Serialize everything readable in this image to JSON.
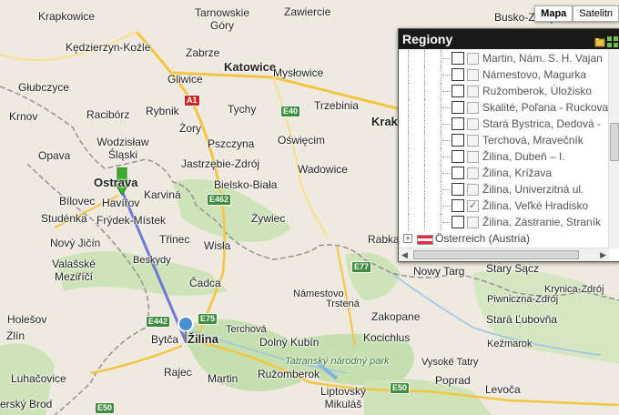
{
  "map_type": {
    "map_label": "Mapa",
    "satellite_label": "Satelitn"
  },
  "panel": {
    "title": "Regiony",
    "rows": [
      {
        "label": "Martin, Nám. S. H. Vajan",
        "checked": false
      },
      {
        "label": "Námestovo, Magurka",
        "checked": false
      },
      {
        "label": "Ružomberok, Úložisko",
        "checked": false
      },
      {
        "label": "Skalité, Poľana - Ruckova",
        "checked": false
      },
      {
        "label": "Stará Bystrica, Dedová -",
        "checked": false
      },
      {
        "label": "Terchová, Mravečník",
        "checked": false
      },
      {
        "label": "Žilina, Dubeň – I.",
        "checked": false
      },
      {
        "label": "Žilina, Krížava",
        "checked": false
      },
      {
        "label": "Žilina, Univerzitná ul.",
        "checked": false
      },
      {
        "label": "Žilina, Veľké Hradisko",
        "checked": true
      },
      {
        "label": "Žilina, Zástranie, Straník",
        "checked": false
      }
    ],
    "country": {
      "expander": "+",
      "label": "Österreich (Austria)"
    }
  },
  "map": {
    "places": {
      "krapkowice": "Krapkowice",
      "tarnowskie_gory": "Tarnowskie\nGóry",
      "zawiercie": "Zawiercie",
      "busko": "Busko-Zdrój",
      "kedzierzyn": "Kędzierzyn-Koźle",
      "zabrze": "Zabrze",
      "katowice": "Katowice",
      "gliwice": "Gliwice",
      "mieszowice": "Mysłowice",
      "glubczyce": "Głubczyce",
      "racibórz": "Racibórz",
      "rybnik": "Rybnik",
      "tychy": "Tychy",
      "trzebinia": "Trzebinia",
      "krnov": "Krnov",
      "zory": "Żory",
      "krak": "Krak",
      "wodzislaw": "Wodzisław\nŚląski",
      "pszczyna": "Pszczyna",
      "oswiecim": "Oświęcim",
      "opava": "Opava",
      "jastrzebie": "Jastrzębie-Zdrój",
      "wadowice": "Wadowice",
      "ostrava": "Ostrava",
      "karvina": "Karviná",
      "havirov": "Havířov",
      "bielsko": "Bielsko-Biała",
      "bilovec": "Bílovec",
      "studenka": "Studénka",
      "frydek": "Frýdek-Místek",
      "zywiec": "Żywiec",
      "rabka": "Rabka",
      "novy_jicin": "Nový Jičín",
      "trinec": "Třinec",
      "wisla": "Wisła",
      "valasske": "Valašské\nMeziříčí",
      "beskydy": "Beskydy",
      "cadca": "Čadca",
      "nowy_targ": "Nowy Targ",
      "stary_sacz": "Stary Sącz",
      "namestovo": "Námestovo",
      "trstena": "Trstená",
      "zakopane": "Zakopane",
      "piwniczna": "Piwniczna-Zdrój",
      "krynica": "Krynica-Zdrój",
      "holesov": "Holešov",
      "terchova": "Terchová",
      "stara_lubovna": "Stará Ľubovňa",
      "kocichlus": "Kocichlus",
      "zlin": "Zlín",
      "bytca": "Bytča",
      "zilina": "Žilina",
      "dolny_kubin": "Dolný Kubín",
      "kezmarok": "Kežmarok",
      "vysoke_tatry": "Vysoké Tatry",
      "tatransky": "Tatranský národný park",
      "rajec": "Rajec",
      "luhacovice": "Luhačovice",
      "martin": "Martin",
      "ruzomberok": "Ružomberok",
      "poprad": "Poprad",
      "levoca": "Levoča",
      "liptovsky": "Liptovský\nMikuláš",
      "brod": "erský Brod"
    },
    "shields": {
      "a1": "A1",
      "e40": "E40",
      "e462": "E462",
      "e75": "E75",
      "e442": "E442",
      "e77": "E77",
      "e50a": "E50",
      "e50b": "E50"
    }
  }
}
